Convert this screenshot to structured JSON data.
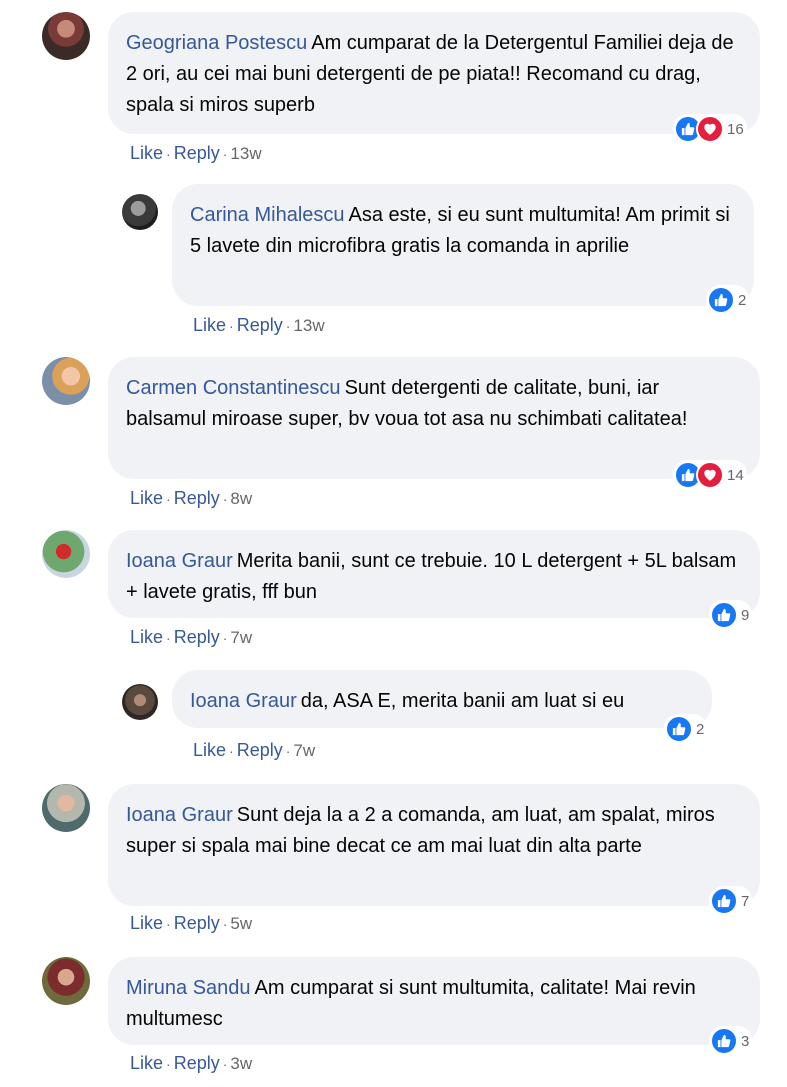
{
  "comments": [
    {
      "author": "Geogriana Postescu",
      "text": "Am cumparat de la Detergentul Familiei deja de 2 ori, au cei mai buni detergenti de pe piata!! Recomand cu drag, spala si miros superb",
      "like_label": "Like",
      "reply_label": "Reply",
      "time": "13w",
      "reaction_count": "16",
      "reactions": [
        "like-icon",
        "love-icon"
      ]
    },
    {
      "author": "Carina Mihalescu",
      "text": "Asa este, si eu sunt multumita! Am primit si 5 lavete din microfibra gratis la comanda in aprilie",
      "like_label": "Like",
      "reply_label": "Reply",
      "time": "13w",
      "reaction_count": "2",
      "reactions": [
        "like-icon"
      ]
    },
    {
      "author": "Carmen Constantinescu",
      "text": "Sunt detergenti de calitate, buni, iar balsamul miroase super, bv voua tot asa nu schimbati calitatea!",
      "like_label": "Like",
      "reply_label": "Reply",
      "time": "8w",
      "reaction_count": "14",
      "reactions": [
        "like-icon",
        "love-icon"
      ]
    },
    {
      "author": "Ioana Graur",
      "text": "Merita banii, sunt ce trebuie. 10 L detergent + 5L balsam + lavete gratis, fff bun",
      "like_label": "Like",
      "reply_label": "Reply",
      "time": "7w",
      "reaction_count": "9",
      "reactions": [
        "like-icon"
      ]
    },
    {
      "author": "Ioana Graur",
      "text": "da, ASA E, merita banii am luat si eu",
      "like_label": "Like",
      "reply_label": "Reply",
      "time": "7w",
      "reaction_count": "2",
      "reactions": [
        "like-icon"
      ]
    },
    {
      "author": "Ioana Graur",
      "text": "Sunt deja la a 2 a comanda, am luat, am spalat, miros super si spala mai bine decat ce am mai luat din alta parte",
      "like_label": "Like",
      "reply_label": "Reply",
      "time": "5w",
      "reaction_count": "7",
      "reactions": [
        "like-icon"
      ]
    },
    {
      "author": "Miruna Sandu",
      "text": "Am cumparat si sunt multumita, calitate! Mai revin multumesc",
      "like_label": "Like",
      "reply_label": "Reply",
      "time": "3w",
      "reaction_count": "3",
      "reactions": [
        "like-icon"
      ]
    }
  ],
  "colors": {
    "link": "#385898",
    "author": "#365899",
    "bubble": "#f0f2f5",
    "like": "#1877f2",
    "love": "#e41e3f"
  }
}
